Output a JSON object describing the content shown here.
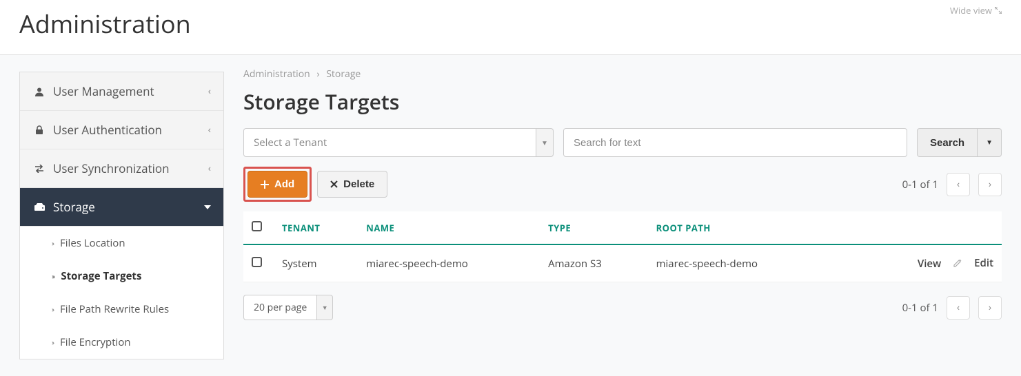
{
  "header": {
    "title": "Administration",
    "wide_view": "Wide view"
  },
  "sidebar": {
    "items": [
      {
        "label": "User Management",
        "icon": "user-icon"
      },
      {
        "label": "User Authentication",
        "icon": "lock-icon"
      },
      {
        "label": "User Synchronization",
        "icon": "exchange-icon"
      },
      {
        "label": "Storage",
        "icon": "disk-icon"
      }
    ],
    "sub_items": [
      {
        "label": "Files Location"
      },
      {
        "label": "Storage Targets"
      },
      {
        "label": "File Path Rewrite Rules"
      },
      {
        "label": "File Encryption"
      }
    ]
  },
  "breadcrumb": {
    "root": "Administration",
    "leaf": "Storage"
  },
  "main": {
    "title": "Storage Targets",
    "tenant_placeholder": "Select a Tenant",
    "search_placeholder": "Search for text",
    "search_btn": "Search",
    "add_btn": "Add",
    "delete_btn": "Delete",
    "range_text": "0-1 of 1",
    "perpage": "20 per page",
    "columns": {
      "tenant": "TENANT",
      "name": "NAME",
      "type": "TYPE",
      "root": "ROOT PATH"
    },
    "rows": [
      {
        "tenant": "System",
        "name": "miarec-speech-demo",
        "type": "Amazon S3",
        "root": "miarec-speech-demo"
      }
    ],
    "view_label": "View",
    "edit_label": "Edit"
  }
}
